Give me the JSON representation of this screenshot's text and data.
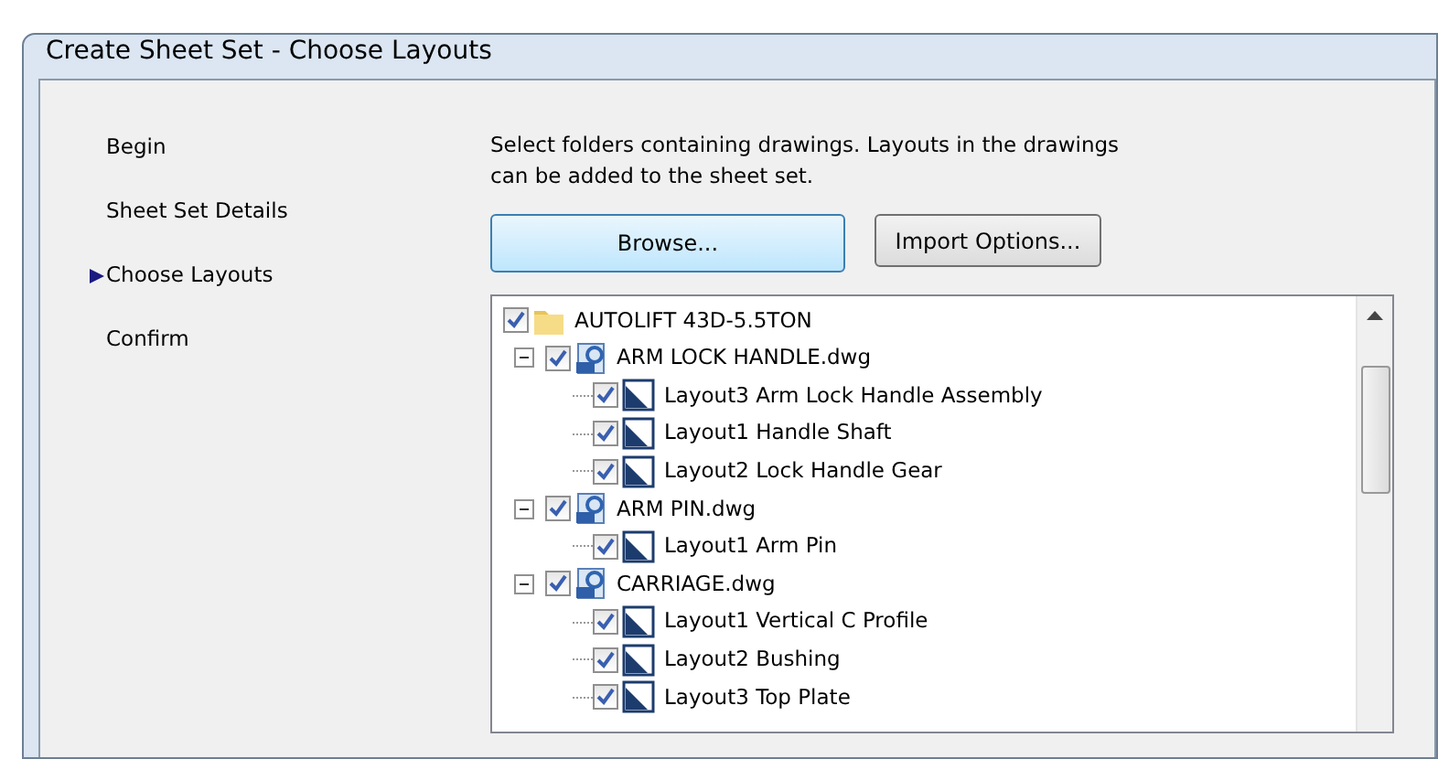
{
  "window": {
    "title": "Create Sheet Set - Choose Layouts"
  },
  "steps": [
    {
      "label": "Begin",
      "selected": false
    },
    {
      "label": "Sheet Set Details",
      "selected": false
    },
    {
      "label": "Choose Layouts",
      "selected": true
    },
    {
      "label": "Confirm",
      "selected": false
    }
  ],
  "description": "Select folders containing drawings.  Layouts in the drawings can be added to the sheet set.",
  "buttons": [
    {
      "label": "Browse...",
      "kind": "primary"
    },
    {
      "label": "Import Options...",
      "kind": "secondary"
    }
  ],
  "tree": [
    {
      "label": "AUTOLIFT 43D-5.5TON",
      "kind": "folder",
      "checked": true,
      "children": [
        {
          "label": "ARM LOCK HANDLE.dwg",
          "kind": "drawing",
          "checked": true,
          "expanded": true,
          "children": [
            {
              "label": "Layout3 Arm Lock Handle Assembly",
              "kind": "layout",
              "checked": true
            },
            {
              "label": "Layout1 Handle Shaft",
              "kind": "layout",
              "checked": true
            },
            {
              "label": "Layout2 Lock Handle Gear",
              "kind": "layout",
              "checked": true
            }
          ]
        },
        {
          "label": "ARM PIN.dwg",
          "kind": "drawing",
          "checked": true,
          "expanded": true,
          "children": [
            {
              "label": "Layout1 Arm Pin",
              "kind": "layout",
              "checked": true
            }
          ]
        },
        {
          "label": "CARRIAGE.dwg",
          "kind": "drawing",
          "checked": true,
          "expanded": true,
          "children": [
            {
              "label": "Layout1 Vertical C Profile",
              "kind": "layout",
              "checked": true
            },
            {
              "label": "Layout2 Bushing",
              "kind": "layout",
              "checked": true
            },
            {
              "label": "Layout3 Top Plate",
              "kind": "layout",
              "checked": true
            }
          ]
        }
      ]
    }
  ]
}
